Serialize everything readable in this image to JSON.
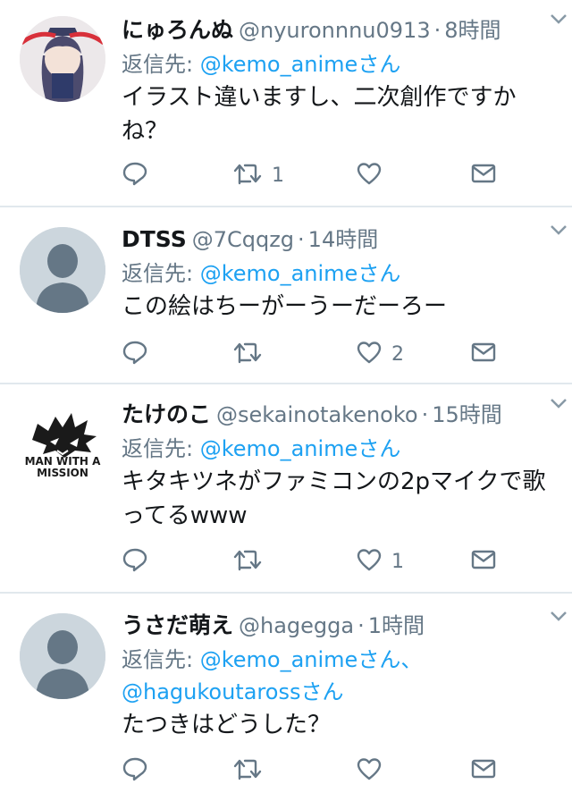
{
  "reply_prefix": "返信先: ",
  "tweets": [
    {
      "display_name": "にゅろんぬ",
      "handle": "@nyuronnnu0913",
      "separator": "·",
      "time": "8時間",
      "mentions": [
        "@kemo_animeさん"
      ],
      "mention_separator": "",
      "text": "イラスト違いますし、二次創作ですかね？",
      "reply_count": "",
      "retweet_count": "1",
      "like_count": ""
    },
    {
      "display_name": "DTSS",
      "handle": "@7Cqqzg",
      "separator": "·",
      "time": "14時間",
      "mentions": [
        "@kemo_animeさん"
      ],
      "mention_separator": "",
      "text": "この絵はちーがーうーだーろー",
      "reply_count": "",
      "retweet_count": "",
      "like_count": "2"
    },
    {
      "display_name": "たけのこ",
      "handle": "@sekainotakenoko",
      "separator": "·",
      "time": "15時間",
      "mentions": [
        "@kemo_animeさん"
      ],
      "mention_separator": "",
      "text": "キタキツネがファミコンの2pマイクで歌ってるwww",
      "avatar_text": [
        "MAN WITH A",
        "MISSION"
      ],
      "reply_count": "",
      "retweet_count": "",
      "like_count": "1"
    },
    {
      "display_name": "うさだ萌え",
      "handle": "@hagegga",
      "separator": "·",
      "time": "1時間",
      "mentions": [
        "@kemo_animeさん",
        "@hagukoutarossさん"
      ],
      "mention_separator": "、",
      "text": "たつきはどうした？",
      "reply_count": "",
      "retweet_count": "",
      "like_count": ""
    }
  ],
  "icons": {
    "reply": "reply-icon",
    "retweet": "retweet-icon",
    "like": "heart-icon",
    "dm": "envelope-icon",
    "menu": "chevron-down-icon"
  },
  "colors": {
    "link": "#1da1f2",
    "secondary": "#657786",
    "icon": "#657786",
    "divider": "#e1e8ed"
  }
}
